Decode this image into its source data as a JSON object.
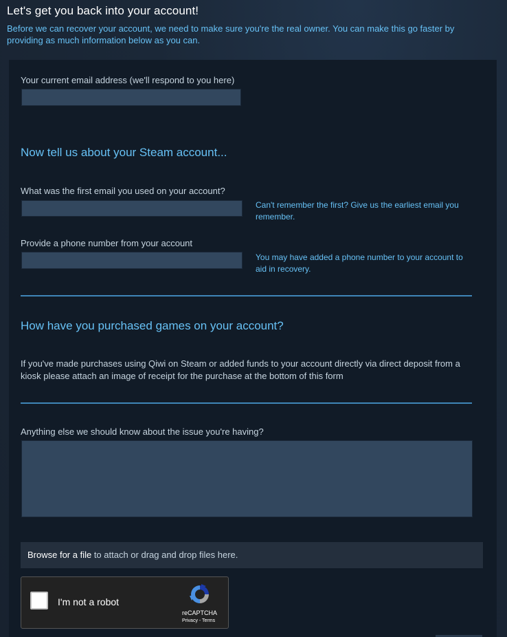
{
  "header": {
    "title": "Let's get you back into your account!",
    "intro": "Before we can recover your account, we need to make sure you're the real owner. You can make this go faster by providing as much information below as you can."
  },
  "contact": {
    "email_label": "Your current email address (we'll respond to you here)",
    "email_value": ""
  },
  "account_section": {
    "heading": "Now tell us about your Steam account...",
    "first_email_label": "What was the first email you used on your account?",
    "first_email_value": "",
    "first_email_hint": "Can't remember the first? Give us the earliest email you remember.",
    "phone_label": "Provide a phone number from your account",
    "phone_value": "",
    "phone_hint": "You may have added a phone number to your account to aid in recovery."
  },
  "purchases_section": {
    "heading": "How have you purchased games on your account?",
    "description": "If you've made purchases using Qiwi on Steam or added funds to your account directly via direct deposit from a kiosk please attach an image of receipt for the purchase at the bottom of this form"
  },
  "issue_section": {
    "label": "Anything else we should know about the issue you're having?",
    "value": ""
  },
  "attachments": {
    "browse_label": "Browse for a file",
    "drop_text": " to attach or drag and drop files here."
  },
  "captcha": {
    "label": "I'm not a robot",
    "brand": "reCAPTCHA",
    "links": "Privacy - Terms",
    "icon": "recaptcha-logo-icon"
  },
  "colors": {
    "accent": "#67c1f5",
    "input_bg": "#32475e",
    "panel_bg": "#111b27"
  }
}
